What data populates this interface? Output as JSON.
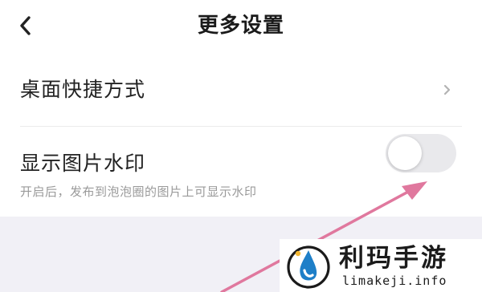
{
  "header": {
    "title": "更多设置",
    "back_icon": "chevron-left-icon"
  },
  "settings": {
    "shortcut": {
      "label": "桌面快捷方式",
      "icon": "chevron-right-icon"
    },
    "watermark": {
      "label": "显示图片水印",
      "description": "开启后，发布到泡泡圈的图片上可显示水印",
      "toggle_on": false
    }
  },
  "overlay": {
    "arrow_color": "#e0789e"
  },
  "site_watermark": {
    "name": "利玛手游",
    "domain": "limakeji.info",
    "logo_icon": "water-drop-logo-icon"
  }
}
